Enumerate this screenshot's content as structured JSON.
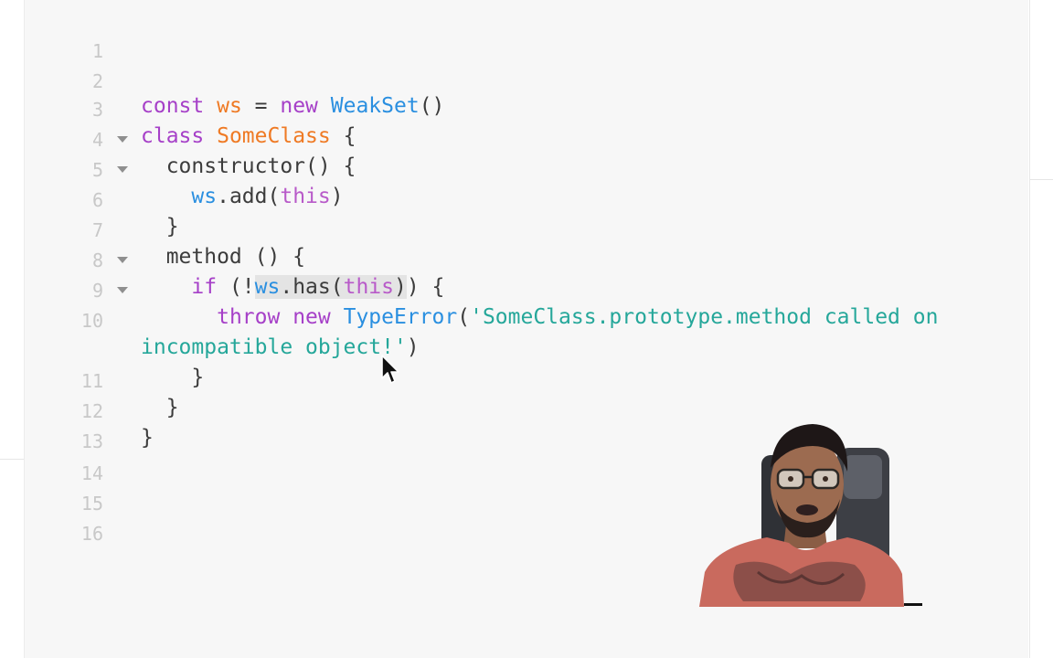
{
  "editor": {
    "lines": [
      {
        "num": "1"
      },
      {
        "num": "2"
      },
      {
        "num": "3",
        "tokens": {
          "t1": "const",
          "t2": " ",
          "t3": "ws",
          "t4": " = ",
          "t5": "new",
          "t6": " ",
          "t7": "WeakSet",
          "t8": "()"
        }
      },
      {
        "num": "4",
        "tokens": {
          "t1": "class",
          "t2": " ",
          "t3": "SomeClass",
          "t4": " {"
        }
      },
      {
        "num": "5",
        "tokens": {
          "t1": "  constructor() {"
        }
      },
      {
        "num": "6",
        "tokens": {
          "t1": "    ",
          "t2": "ws",
          "t3": ".add(",
          "t4": "this",
          "t5": ")"
        }
      },
      {
        "num": "7",
        "tokens": {
          "t1": "  }"
        }
      },
      {
        "num": "8",
        "tokens": {
          "t1": "  method () {"
        }
      },
      {
        "num": "9",
        "tokens": {
          "t1": "    ",
          "t2": "if",
          "t3": " (!",
          "t4": "ws",
          "t5": ".has(",
          "t6": "this",
          "t7": ")",
          "t8": ") {"
        }
      },
      {
        "num": "10",
        "tokens": {
          "t1": "      ",
          "t2": "throw",
          "t3": " ",
          "t4": "new",
          "t5": " ",
          "t6": "TypeError",
          "t7": "(",
          "t8": "'SomeClass.prototype.method called on"
        },
        "continuation": {
          "t1": "incompatible object!'",
          "t2": ")"
        }
      },
      {
        "num": "11",
        "tokens": {
          "t1": "    }"
        }
      },
      {
        "num": "12",
        "tokens": {
          "t1": "  }"
        }
      },
      {
        "num": "13",
        "tokens": {
          "t1": "}"
        }
      },
      {
        "num": "14"
      },
      {
        "num": "15"
      },
      {
        "num": "16"
      }
    ]
  },
  "colors": {
    "keyword": "#a640c8",
    "variable": "#ef7a24",
    "class": "#2a8fe0",
    "string": "#25a79a",
    "background": "#f7f7f7"
  },
  "icons": [
    "fold-arrow-icon",
    "mouse-pointer-icon"
  ]
}
